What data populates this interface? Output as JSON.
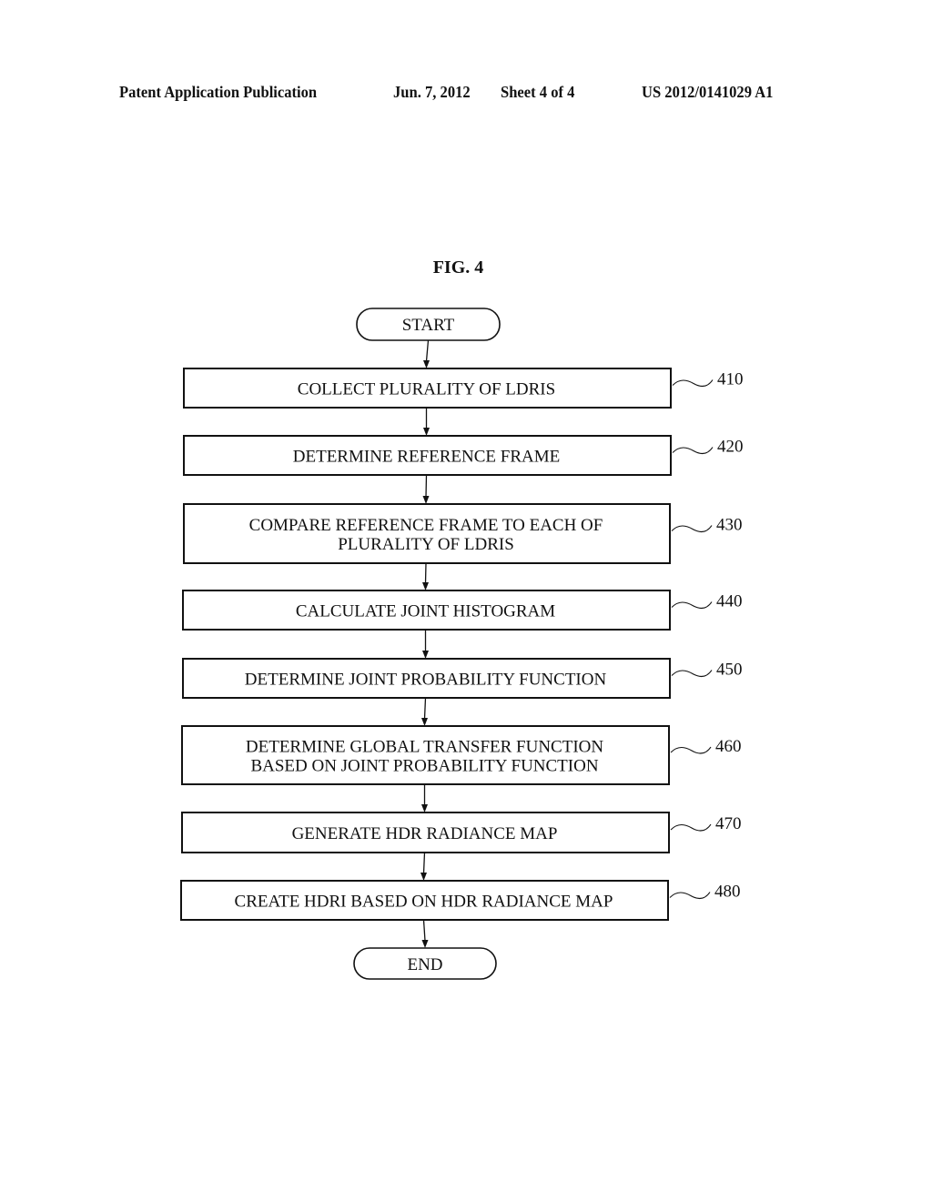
{
  "header": {
    "publication_type": "Patent Application Publication",
    "date": "Jun. 7, 2012",
    "sheet": "Sheet 4 of 4",
    "publication_number": "US 2012/0141029 A1"
  },
  "figure": {
    "title": "FIG. 4",
    "start_label": "START",
    "end_label": "END",
    "steps": [
      {
        "ref": "410",
        "lines": [
          "COLLECT PLURALITY OF LDRIS"
        ]
      },
      {
        "ref": "420",
        "lines": [
          "DETERMINE REFERENCE FRAME"
        ]
      },
      {
        "ref": "430",
        "lines": [
          "COMPARE REFERENCE FRAME TO EACH OF",
          "PLURALITY OF LDRIS"
        ]
      },
      {
        "ref": "440",
        "lines": [
          "CALCULATE JOINT HISTOGRAM"
        ]
      },
      {
        "ref": "450",
        "lines": [
          "DETERMINE JOINT PROBABILITY FUNCTION"
        ]
      },
      {
        "ref": "460",
        "lines": [
          "DETERMINE GLOBAL TRANSFER FUNCTION",
          "BASED ON JOINT PROBABILITY FUNCTION"
        ]
      },
      {
        "ref": "470",
        "lines": [
          "GENERATE HDR RADIANCE MAP"
        ]
      },
      {
        "ref": "480",
        "lines": [
          "CREATE HDRI BASED ON HDR RADIANCE MAP"
        ]
      }
    ]
  }
}
